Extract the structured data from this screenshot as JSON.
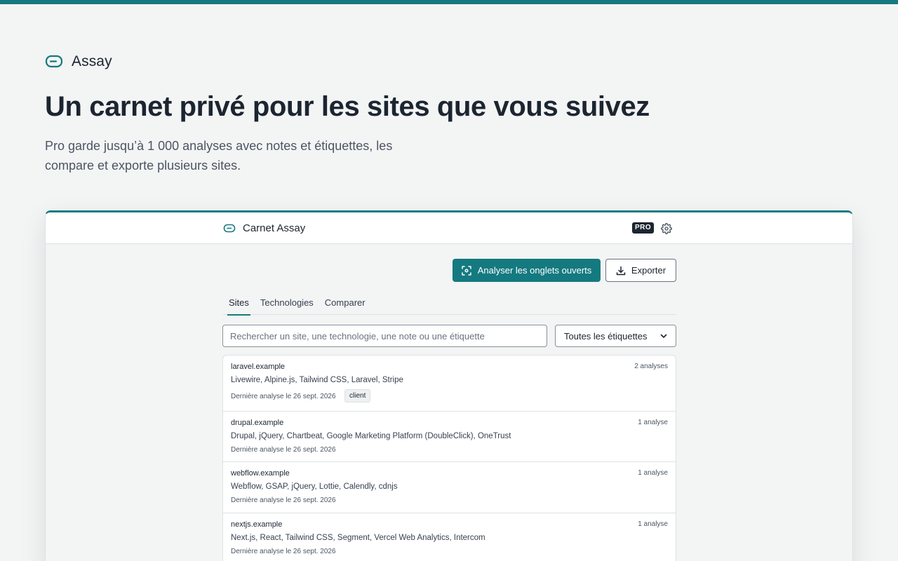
{
  "brand": {
    "name": "Assay",
    "icon": "tag-label-icon"
  },
  "hero": {
    "title": "Un carnet privé pour les sites que vous suivez",
    "subtitle": "Pro garde jusqu’à 1 000 analyses avec notes et étiquettes, les compare et exporte plusieurs sites."
  },
  "app": {
    "title": "Carnet Assay",
    "badge": "PRO",
    "settings_icon": "gear-icon",
    "actions": {
      "scan_label": "Analyser les onglets ouverts",
      "scan_icon": "scan-icon",
      "export_label": "Exporter",
      "export_icon": "download-icon"
    },
    "tabs": [
      {
        "label": "Sites",
        "active": true
      },
      {
        "label": "Technologies",
        "active": false
      },
      {
        "label": "Comparer",
        "active": false
      }
    ],
    "search": {
      "placeholder": "Rechercher un site, une technologie, une note ou une étiquette",
      "value": ""
    },
    "filter": {
      "selected": "Toutes les étiquettes"
    },
    "sites": [
      {
        "domain": "laravel.example",
        "count": "2 analyses",
        "techs": "Livewire, Alpine.js, Tailwind CSS, Laravel, Stripe",
        "last": "Dernière analyse le 26 sept. 2026",
        "tags": [
          "client"
        ]
      },
      {
        "domain": "drupal.example",
        "count": "1 analyse",
        "techs": "Drupal, jQuery, Chartbeat, Google Marketing Platform (DoubleClick), OneTrust",
        "last": "Dernière analyse le 26 sept. 2026",
        "tags": []
      },
      {
        "domain": "webflow.example",
        "count": "1 analyse",
        "techs": "Webflow, GSAP, jQuery, Lottie, Calendly, cdnjs",
        "last": "Dernière analyse le 26 sept. 2026",
        "tags": []
      },
      {
        "domain": "nextjs.example",
        "count": "1 analyse",
        "techs": "Next.js, React, Tailwind CSS, Segment, Vercel Web Analytics, Intercom",
        "last": "Dernière analyse le 26 sept. 2026",
        "tags": []
      }
    ]
  },
  "colors": {
    "accent": "#147a80",
    "text": "#1c2530",
    "background": "#f3f4f4"
  }
}
